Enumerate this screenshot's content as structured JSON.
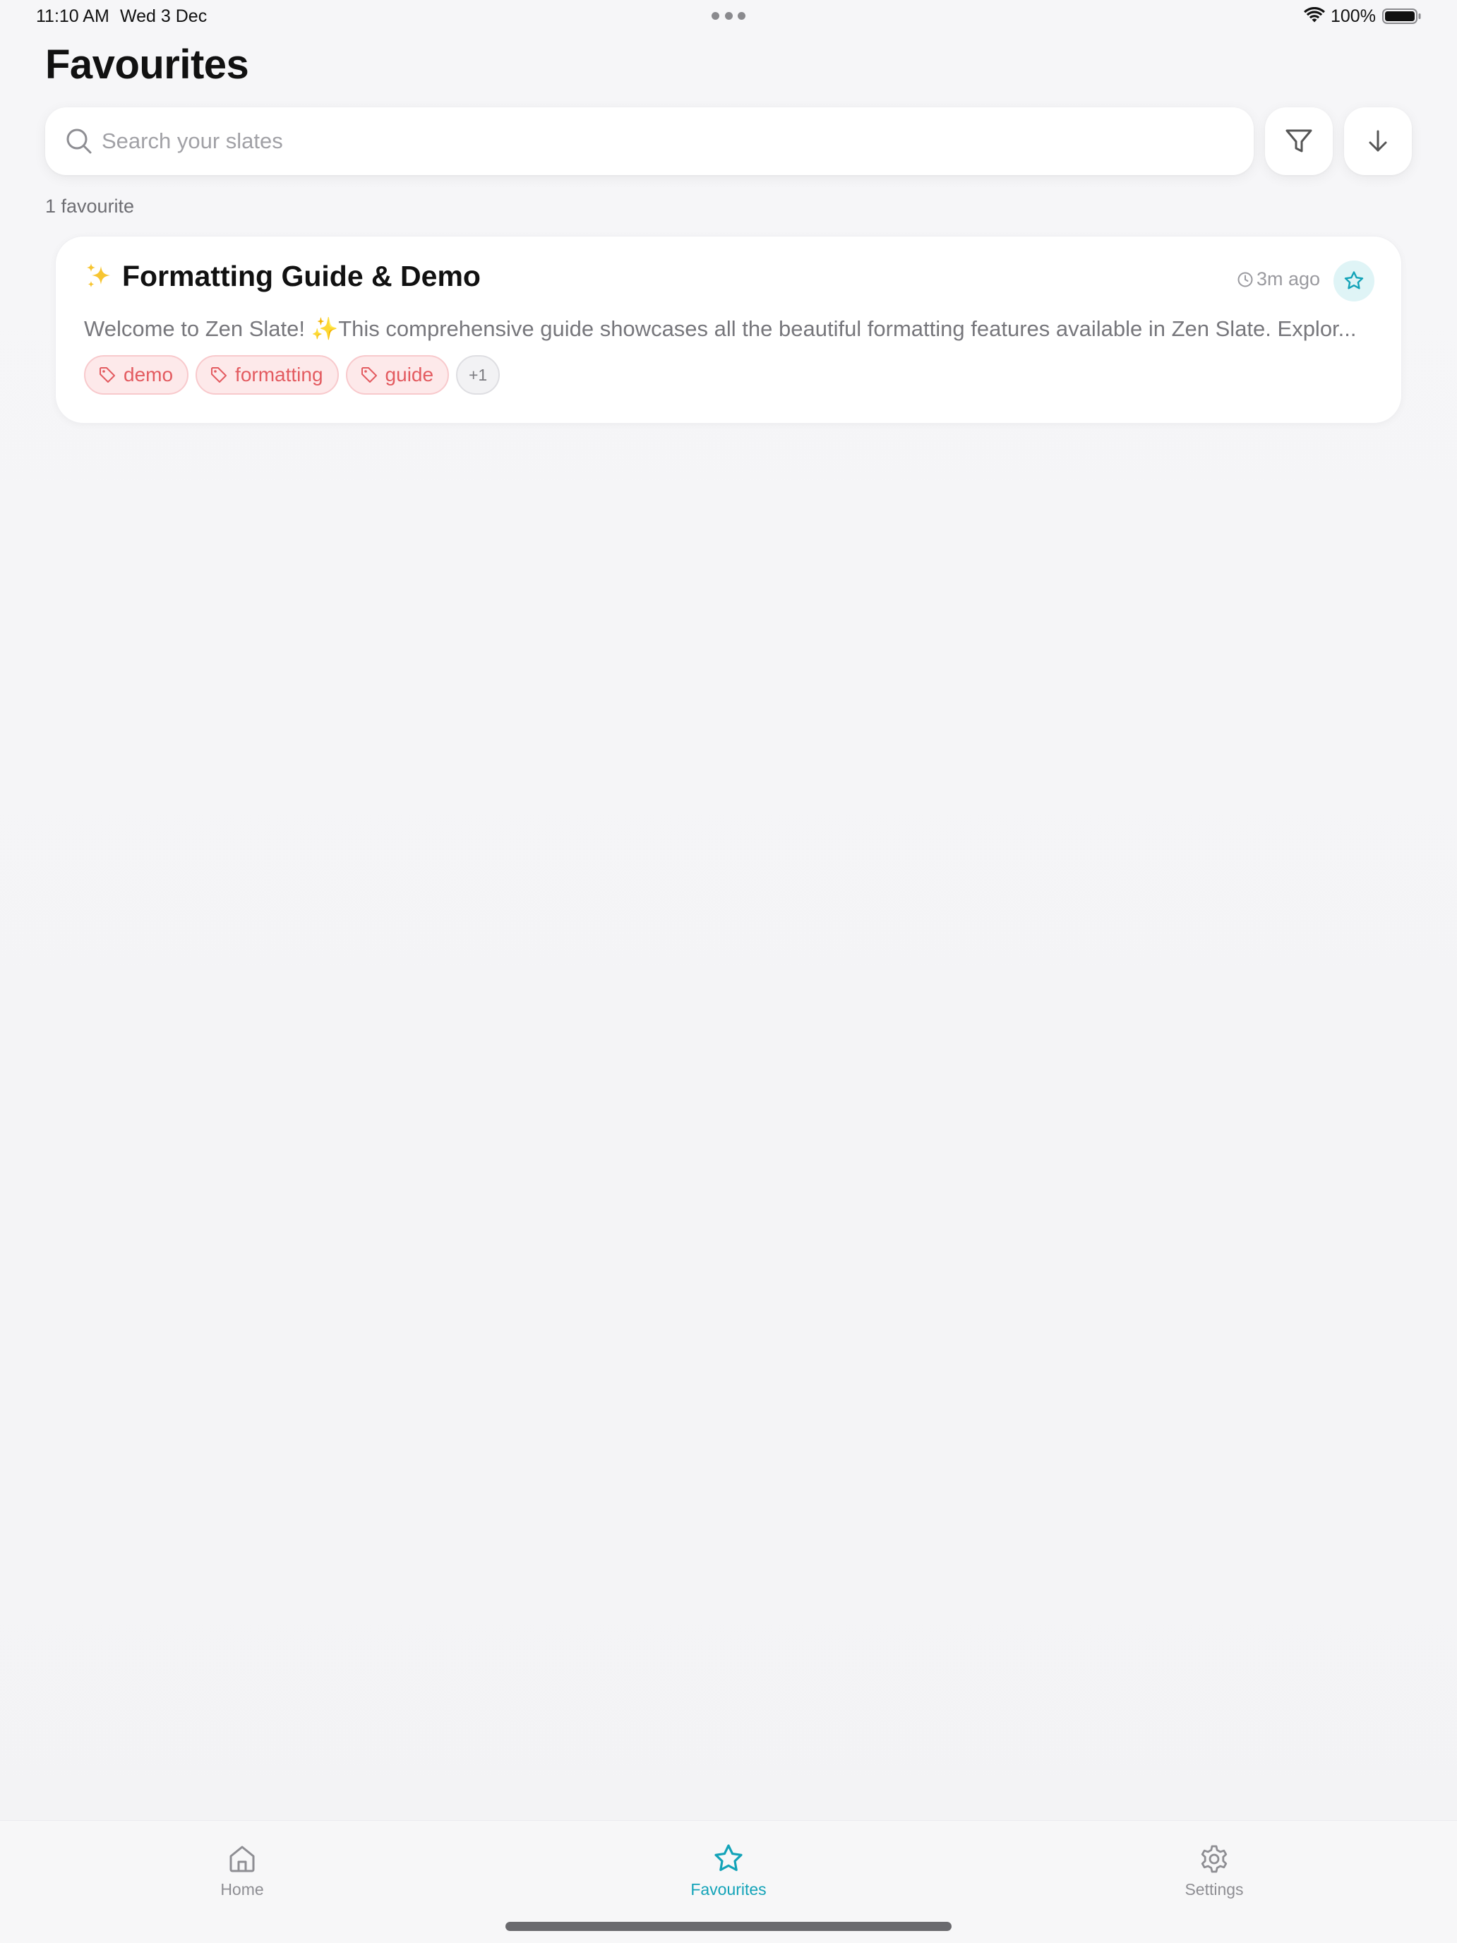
{
  "status_bar": {
    "time": "11:10 AM",
    "date": "Wed 3 Dec",
    "battery": "100%"
  },
  "header": {
    "title": "Favourites"
  },
  "search": {
    "placeholder": "Search your slates",
    "value": ""
  },
  "list": {
    "count_label": "1 favourite",
    "items": [
      {
        "title": "Formatting Guide & Demo",
        "time": "3m ago",
        "preview": "Welcome to Zen Slate! ✨This comprehensive guide showcases all the beautiful formatting features available in Zen Slate. Explor...",
        "tags": [
          "demo",
          "formatting",
          "guide"
        ],
        "more_tags": "+1",
        "favourited": true
      }
    ]
  },
  "tab_bar": {
    "tabs": [
      {
        "label": "Home",
        "icon": "home-icon",
        "active": false
      },
      {
        "label": "Favourites",
        "icon": "star-icon",
        "active": true
      },
      {
        "label": "Settings",
        "icon": "gear-icon",
        "active": false
      }
    ]
  },
  "colors": {
    "accent": "#13a3b8",
    "tag_text": "#e35b60",
    "tag_bg": "#fde9ea"
  }
}
